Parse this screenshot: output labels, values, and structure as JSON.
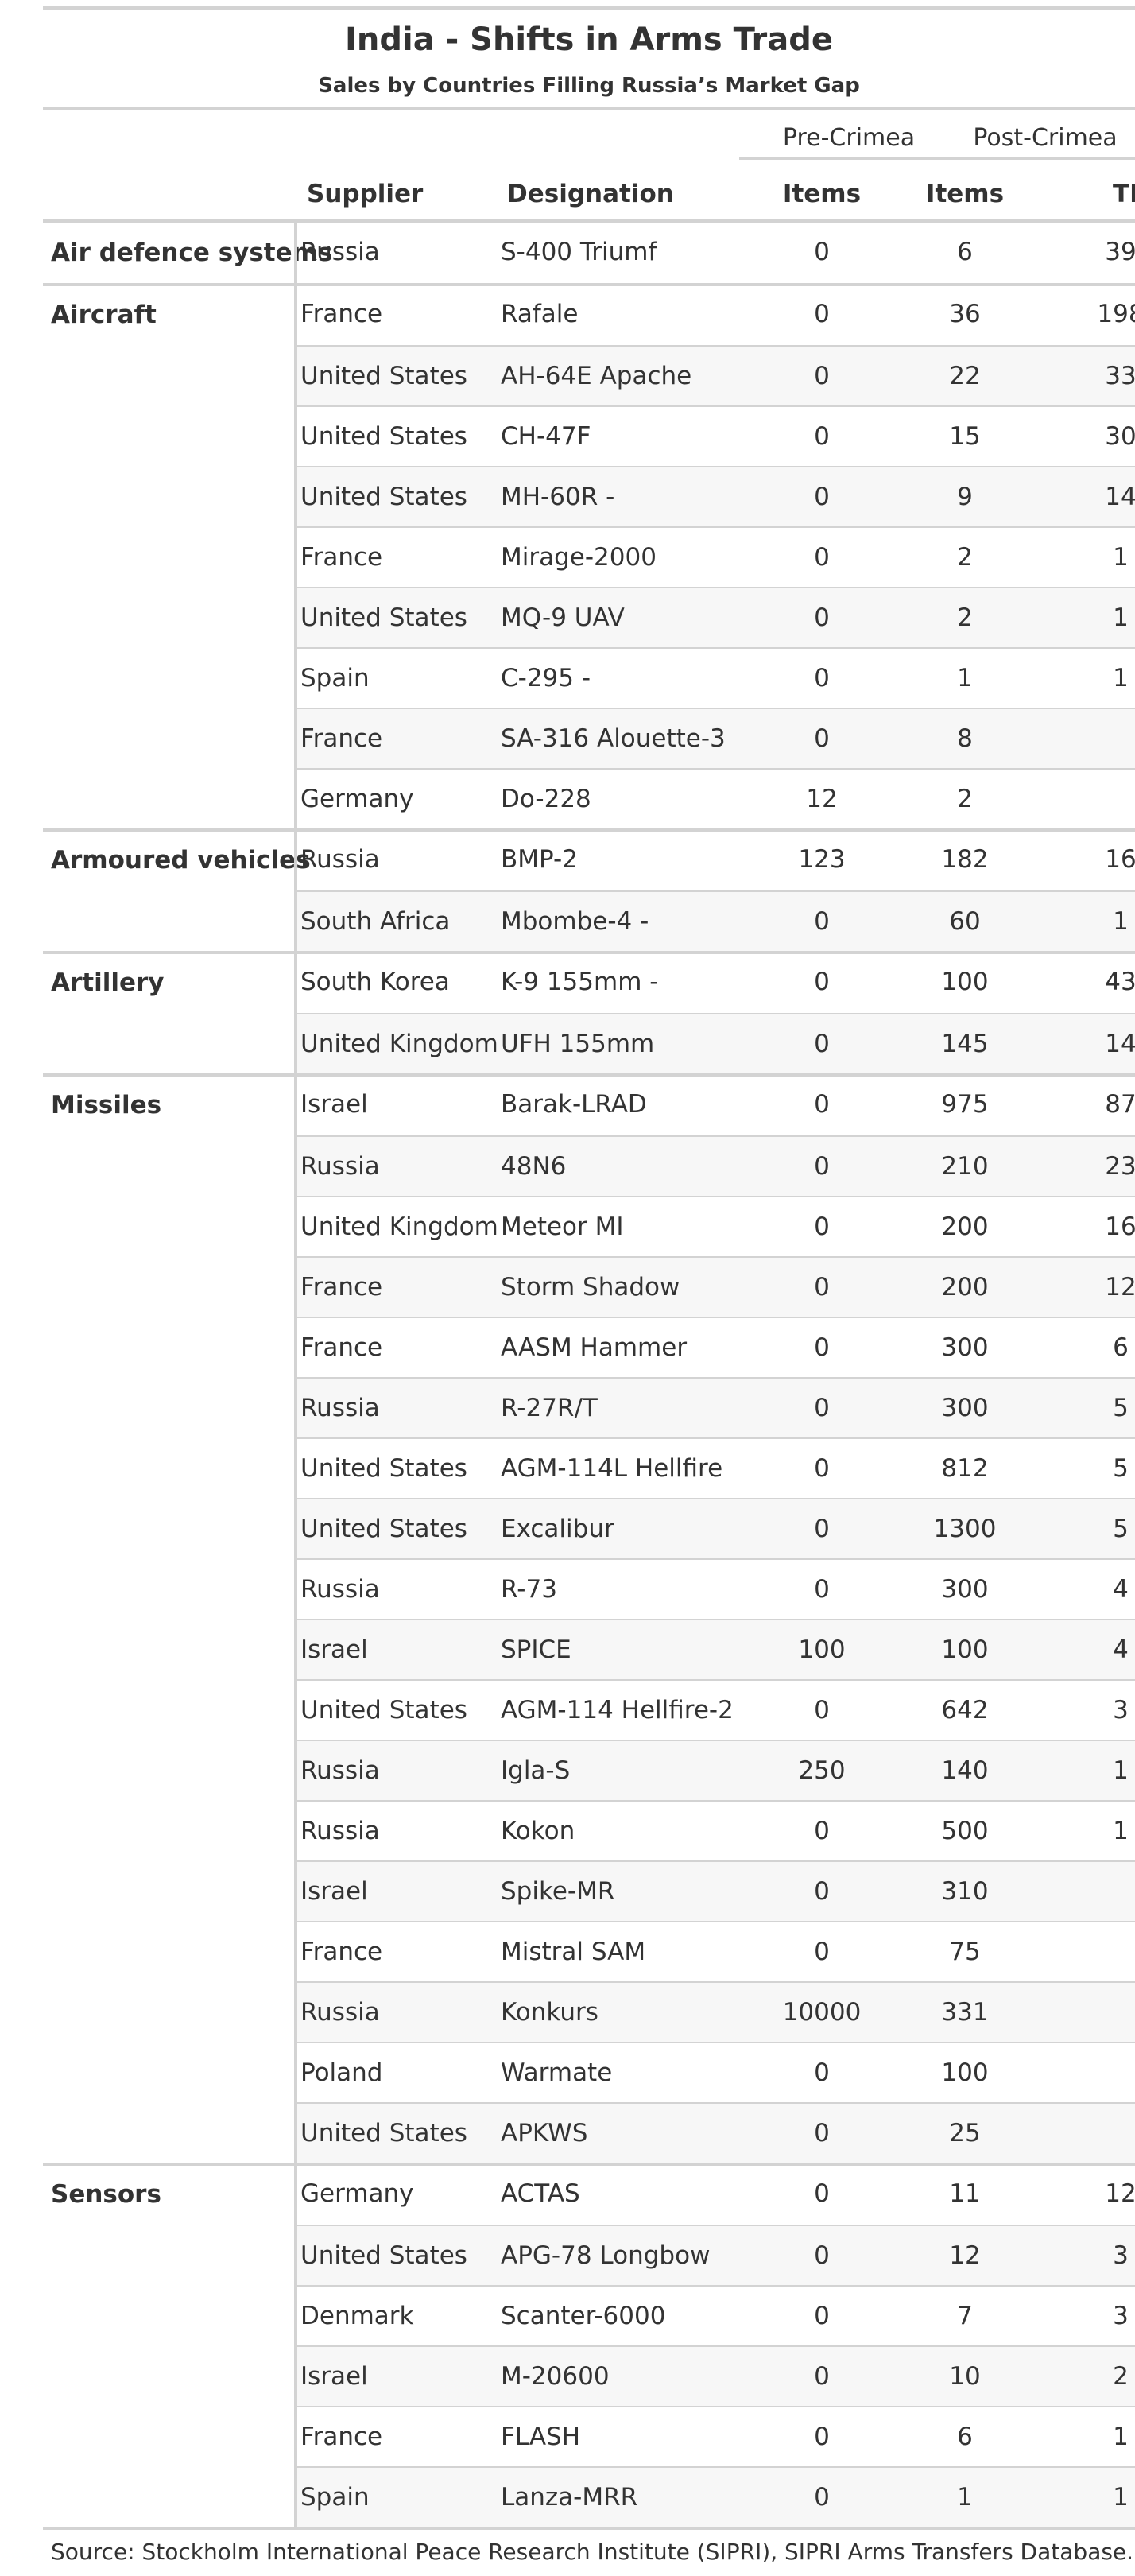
{
  "title": "India - Shifts in Arms Trade",
  "subtitle": "Sales by Countries Filling Russia’s Market Gap",
  "spanners": {
    "pre": "Pre-Crimea",
    "post": "Post-Crimea"
  },
  "columns": {
    "supplier": "Supplier",
    "designation": "Designation",
    "pre_items": "Items",
    "post_items": "Items",
    "post_tiv_partial": "TI"
  },
  "groups": [
    {
      "name": "Air defence systems",
      "rows": [
        {
          "supplier": "Russia",
          "designation": "S-400 Triumf",
          "pre_items": "0",
          "post_items": "6",
          "tiv": "39"
        }
      ]
    },
    {
      "name": "Aircraft",
      "rows": [
        {
          "supplier": "France",
          "designation": "Rafale",
          "pre_items": "0",
          "post_items": "36",
          "tiv": "198"
        },
        {
          "supplier": "United States",
          "designation": "AH-64E Apache",
          "pre_items": "0",
          "post_items": "22",
          "tiv": "33"
        },
        {
          "supplier": "United States",
          "designation": "CH-47F",
          "pre_items": "0",
          "post_items": "15",
          "tiv": "30"
        },
        {
          "supplier": "United States",
          "designation": "MH-60R -",
          "pre_items": "0",
          "post_items": "9",
          "tiv": "14"
        },
        {
          "supplier": "France",
          "designation": "Mirage-2000",
          "pre_items": "0",
          "post_items": "2",
          "tiv": "1"
        },
        {
          "supplier": "United States",
          "designation": "MQ-9 UAV",
          "pre_items": "0",
          "post_items": "2",
          "tiv": "1"
        },
        {
          "supplier": "Spain",
          "designation": "C-295 -",
          "pre_items": "0",
          "post_items": "1",
          "tiv": "1"
        },
        {
          "supplier": "France",
          "designation": "SA-316 Alouette-3",
          "pre_items": "0",
          "post_items": "8",
          "tiv": ""
        },
        {
          "supplier": "Germany",
          "designation": "Do-228",
          "pre_items": "12",
          "post_items": "2",
          "tiv": ""
        }
      ]
    },
    {
      "name": "Armoured vehicles",
      "rows": [
        {
          "supplier": "Russia",
          "designation": "BMP-2",
          "pre_items": "123",
          "post_items": "182",
          "tiv": "16"
        },
        {
          "supplier": "South Africa",
          "designation": "Mbombe-4 -",
          "pre_items": "0",
          "post_items": "60",
          "tiv": "1"
        }
      ]
    },
    {
      "name": "Artillery",
      "rows": [
        {
          "supplier": "South Korea",
          "designation": "K-9 155mm -",
          "pre_items": "0",
          "post_items": "100",
          "tiv": "43"
        },
        {
          "supplier": "United Kingdom",
          "designation": "UFH 155mm",
          "pre_items": "0",
          "post_items": "145",
          "tiv": "14"
        }
      ]
    },
    {
      "name": "Missiles",
      "rows": [
        {
          "supplier": "Israel",
          "designation": "Barak-LRAD",
          "pre_items": "0",
          "post_items": "975",
          "tiv": "87"
        },
        {
          "supplier": "Russia",
          "designation": "48N6",
          "pre_items": "0",
          "post_items": "210",
          "tiv": "23"
        },
        {
          "supplier": "United Kingdom",
          "designation": "Meteor MI",
          "pre_items": "0",
          "post_items": "200",
          "tiv": "16"
        },
        {
          "supplier": "France",
          "designation": "Storm Shadow",
          "pre_items": "0",
          "post_items": "200",
          "tiv": "12"
        },
        {
          "supplier": "France",
          "designation": "AASM Hammer",
          "pre_items": "0",
          "post_items": "300",
          "tiv": "6"
        },
        {
          "supplier": "Russia",
          "designation": "R-27R/T",
          "pre_items": "0",
          "post_items": "300",
          "tiv": "5"
        },
        {
          "supplier": "United States",
          "designation": "AGM-114L Hellfire",
          "pre_items": "0",
          "post_items": "812",
          "tiv": "5"
        },
        {
          "supplier": "United States",
          "designation": "Excalibur",
          "pre_items": "0",
          "post_items": "1300",
          "tiv": "5"
        },
        {
          "supplier": "Russia",
          "designation": "R-73",
          "pre_items": "0",
          "post_items": "300",
          "tiv": "4"
        },
        {
          "supplier": "Israel",
          "designation": "SPICE",
          "pre_items": "100",
          "post_items": "100",
          "tiv": "4"
        },
        {
          "supplier": "United States",
          "designation": "AGM-114 Hellfire-2",
          "pre_items": "0",
          "post_items": "642",
          "tiv": "3"
        },
        {
          "supplier": "Russia",
          "designation": "Igla-S",
          "pre_items": "250",
          "post_items": "140",
          "tiv": "1"
        },
        {
          "supplier": "Russia",
          "designation": "Kokon",
          "pre_items": "0",
          "post_items": "500",
          "tiv": "1"
        },
        {
          "supplier": "Israel",
          "designation": "Spike-MR",
          "pre_items": "0",
          "post_items": "310",
          "tiv": ""
        },
        {
          "supplier": "France",
          "designation": "Mistral SAM",
          "pre_items": "0",
          "post_items": "75",
          "tiv": ""
        },
        {
          "supplier": "Russia",
          "designation": "Konkurs",
          "pre_items": "10000",
          "post_items": "331",
          "tiv": ""
        },
        {
          "supplier": "Poland",
          "designation": "Warmate",
          "pre_items": "0",
          "post_items": "100",
          "tiv": ""
        },
        {
          "supplier": "United States",
          "designation": "APKWS",
          "pre_items": "0",
          "post_items": "25",
          "tiv": ""
        }
      ]
    },
    {
      "name": "Sensors",
      "rows": [
        {
          "supplier": "Germany",
          "designation": "ACTAS",
          "pre_items": "0",
          "post_items": "11",
          "tiv": "12"
        },
        {
          "supplier": "United States",
          "designation": "APG-78 Longbow",
          "pre_items": "0",
          "post_items": "12",
          "tiv": "3"
        },
        {
          "supplier": "Denmark",
          "designation": "Scanter-6000",
          "pre_items": "0",
          "post_items": "7",
          "tiv": "3"
        },
        {
          "supplier": "Israel",
          "designation": "M-20600",
          "pre_items": "0",
          "post_items": "10",
          "tiv": "2"
        },
        {
          "supplier": "France",
          "designation": "FLASH",
          "pre_items": "0",
          "post_items": "6",
          "tiv": "1"
        },
        {
          "supplier": "Spain",
          "designation": "Lanza-MRR",
          "pre_items": "0",
          "post_items": "1",
          "tiv": "1"
        }
      ]
    }
  ],
  "source": "Source: Stockholm International Peace Research Institute (SIPRI), SIPRI Arms Transfers Database."
}
